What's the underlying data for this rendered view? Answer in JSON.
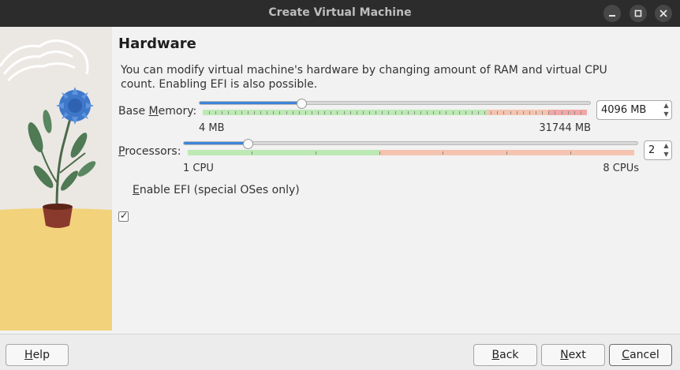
{
  "window": {
    "title": "Create Virtual Machine"
  },
  "page": {
    "heading": "Hardware",
    "description": "You can modify virtual machine's hardware by changing amount of RAM and virtual CPU count. Enabling EFI is also possible."
  },
  "memory": {
    "label_pre": "Base ",
    "label_mnemonic": "M",
    "label_post": "emory:",
    "min_label": "4 MB",
    "max_label": "31744 MB",
    "value_display": "4096 MB",
    "value_mb": 4096,
    "min_mb": 4,
    "max_mb": 31744
  },
  "processors": {
    "label_mnemonic": "P",
    "label_post": "rocessors:",
    "min_label": "1 CPU",
    "max_label": "8 CPUs",
    "value_display": "2",
    "value": 2,
    "min": 1,
    "max": 8
  },
  "efi": {
    "label_mnemonic": "E",
    "label_post": "nable EFI (special OSes only)",
    "checked": true
  },
  "buttons": {
    "help_mnemonic": "H",
    "help_post": "elp",
    "back_mnemonic": "B",
    "back_post": "ack",
    "next_mnemonic": "N",
    "next_post": "ext",
    "cancel_mnemonic": "C",
    "cancel_post": "ancel"
  },
  "icons": [
    "minimize-icon",
    "maximize-icon",
    "close-icon",
    "chevron-up-icon",
    "chevron-down-icon",
    "check-icon"
  ],
  "colors": {
    "accent": "#3d84d8",
    "ok_range": "#bde9b4",
    "warn_range": "#f4c4b0",
    "danger_range": "#f0a8a6"
  }
}
